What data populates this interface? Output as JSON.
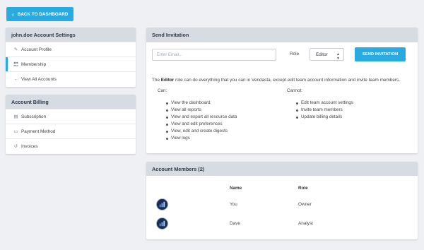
{
  "back_button": {
    "label": "BACK TO DASHBOARD",
    "icon": "chevron-left-icon"
  },
  "settings": {
    "title": "john.doe Account Settings",
    "items": [
      {
        "label": "Account Profile",
        "icon": "edit-icon",
        "glyph": "✎",
        "active": false
      },
      {
        "label": "Membership",
        "icon": "users-icon",
        "glyph": "👥",
        "active": true
      },
      {
        "label": "View All Accounts",
        "icon": "arrow-left-icon",
        "glyph": "←",
        "active": false
      }
    ]
  },
  "billing": {
    "title": "Account Billing",
    "items": [
      {
        "label": "Subscription",
        "icon": "calculator-icon",
        "glyph": "▤"
      },
      {
        "label": "Payment Method",
        "icon": "credit-card-icon",
        "glyph": "▭"
      },
      {
        "label": "Invoices",
        "icon": "history-icon",
        "glyph": "↺"
      }
    ]
  },
  "invite": {
    "title": "Send Invitation",
    "email_placeholder": "Enter Email...",
    "role_label": "Role",
    "role_selected": "Editor",
    "send_label": "SEND INVITATION",
    "desc_prefix": "The ",
    "desc_role": "Editor",
    "desc_suffix": " role can do everything that you can in Vendasta, except edit team account information and invite team members.",
    "can_label": "Can:",
    "cannot_label": "Cannot:",
    "can": [
      "View the dashboard",
      "View all reports",
      "View and export all resource data",
      "View and edit preferences",
      "View, edit and create digests",
      "View logs"
    ],
    "cannot": [
      "Edit team account settings",
      "Invite team members",
      "Update billing details"
    ]
  },
  "members": {
    "title": "Account Members (2)",
    "col_name": "Name",
    "col_role": "Role",
    "rows": [
      {
        "name": "You",
        "role": "Owner"
      },
      {
        "name": "Dave",
        "role": "Analyst"
      }
    ]
  },
  "colors": {
    "accent": "#29aae1",
    "header_bg": "#d7dce3",
    "page_bg": "#eef0f3"
  }
}
